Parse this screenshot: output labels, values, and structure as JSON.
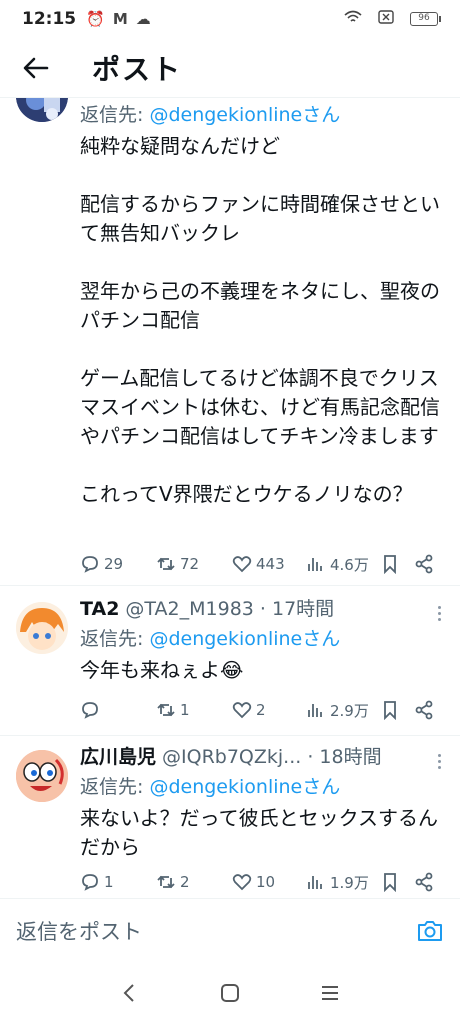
{
  "status_bar": {
    "time": "12:15",
    "battery": "96"
  },
  "header": {
    "title": "ポスト"
  },
  "tweets": [
    {
      "reply_label": "返信先: ",
      "reply_handle": "@dengekionlineさん",
      "text": "純粋な疑問なんだけど\n\n配信するからファンに時間確保させといて無告知バックレ\n\n翌年から己の不義理をネタにし、聖夜のパチンコ配信\n\nゲーム配信してるけど体調不良でクリスマスイベントは休む、けど有馬記念配信やパチンコ配信はしてチキン冷まします\n\nこれってV界隈だとウケるノリなの？",
      "replies": "29",
      "retweets": "72",
      "likes": "443",
      "views": "4.6万"
    },
    {
      "name": "TA2",
      "meta": "@TA2_M1983 · 17時間",
      "reply_label": "返信先: ",
      "reply_handle": "@dengekionlineさん",
      "text": "今年も来ねぇよ😂",
      "replies": "",
      "retweets": "1",
      "likes": "2",
      "views": "2.9万"
    },
    {
      "name": "広川島児",
      "meta": "@IQRb7QZkj... · 18時間",
      "reply_label": "返信先: ",
      "reply_handle": "@dengekionlineさん",
      "text": "来ないよ？だって彼氏とセックスするんだから",
      "replies": "1",
      "retweets": "2",
      "likes": "10",
      "views": "1.9万"
    }
  ],
  "composer": {
    "placeholder": "返信をポスト"
  },
  "icons": {
    "back": "arrow-left-icon",
    "camera": "camera-icon",
    "reply": "speech-bubble-icon",
    "retweet": "retweet-icon",
    "like": "heart-icon",
    "views": "bar-chart-icon",
    "bookmark": "bookmark-icon",
    "share": "share-icon"
  },
  "colors": {
    "accent": "#1d9bf0",
    "muted": "#536471",
    "text": "#0f1419"
  }
}
